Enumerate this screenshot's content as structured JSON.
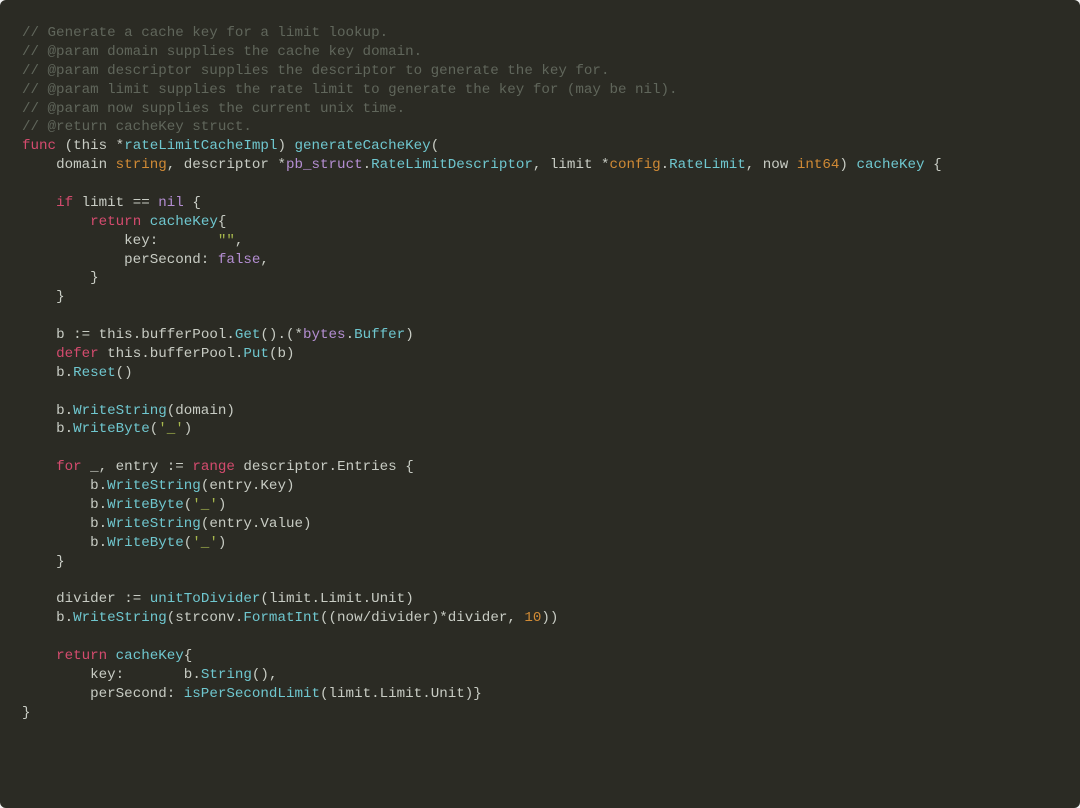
{
  "comments": {
    "c1": "// Generate a cache key for a limit lookup.",
    "c2": "// @param domain supplies the cache key domain.",
    "c3": "// @param descriptor supplies the descriptor to generate the key for.",
    "c4": "// @param limit supplies the rate limit to generate the key for (may be nil).",
    "c5": "// @param now supplies the current unix time.",
    "c6": "// @return cacheKey struct."
  },
  "kw": {
    "func": "func",
    "if": "if",
    "return": "return",
    "defer": "defer",
    "for": "for",
    "range": "range"
  },
  "types": {
    "string": "string",
    "int64": "int64",
    "config": "config",
    "RateLimit": "RateLimit"
  },
  "pkg": {
    "pb_struct": "pb_struct",
    "bytes": "bytes"
  },
  "fn": {
    "rateLimitCacheImpl": "rateLimitCacheImpl",
    "generateCacheKey": "generateCacheKey",
    "RateLimitDescriptor": "RateLimitDescriptor",
    "cacheKey": "cacheKey",
    "Get": "Get",
    "Put": "Put",
    "Reset": "Reset",
    "WriteString": "WriteString",
    "WriteByte": "WriteByte",
    "Buffer": "Buffer",
    "unitToDivider": "unitToDivider",
    "FormatInt": "FormatInt",
    "String": "String",
    "isPerSecondLimit": "isPerSecondLimit"
  },
  "ids": {
    "this": "this",
    "domain": "domain",
    "descriptor": "descriptor",
    "limit": "limit",
    "now": "now",
    "key": "key",
    "perSecond": "perSecond",
    "b": "b",
    "bufferPool": "bufferPool",
    "entry": "entry",
    "Entries": "Entries",
    "Key": "Key",
    "Value": "Value",
    "divider": "divider",
    "Limit": "Limit",
    "Unit": "Unit",
    "strconv": "strconv",
    "underscore": "_"
  },
  "lits": {
    "nil": "nil",
    "false": "false",
    "emptyStr": "\"\"",
    "underscoreRune": "'_'",
    "ten": "10"
  }
}
